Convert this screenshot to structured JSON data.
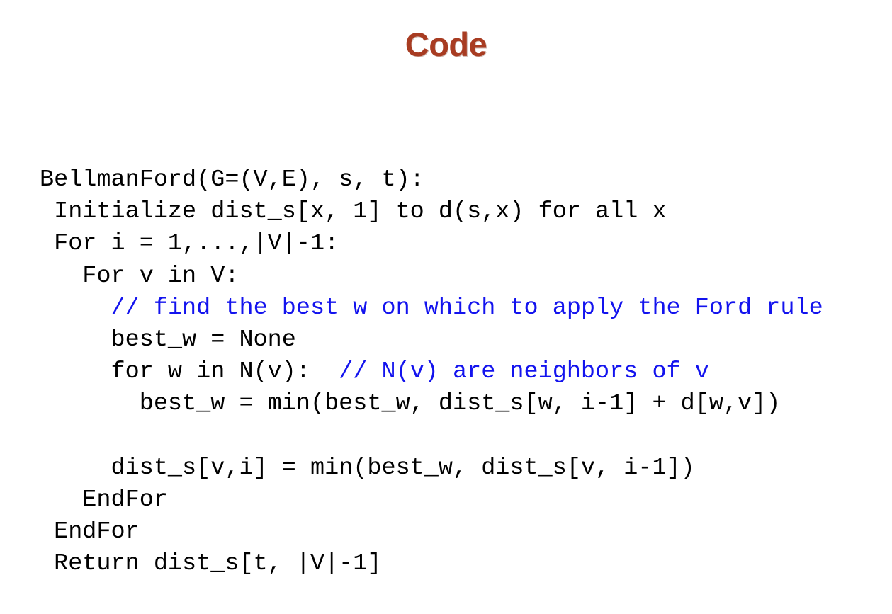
{
  "slide": {
    "title": "Code",
    "title_color": "#A83C22",
    "background_color": "#FFFFFF",
    "code_color": "#000000",
    "comment_color": "#1313EE"
  },
  "code": {
    "language": "pseudocode",
    "algorithm_name": "BellmanFord",
    "lines": [
      {
        "id": "line-1",
        "code": "BellmanFord(G=(V,E), s, t):",
        "comment": ""
      },
      {
        "id": "line-2",
        "code": " Initialize dist_s[x, 1] to d(s,x) for all x",
        "comment": ""
      },
      {
        "id": "line-3",
        "code": " For i = 1,...,|V|-1:",
        "comment": ""
      },
      {
        "id": "line-4",
        "code": "   For v in V:",
        "comment": ""
      },
      {
        "id": "line-5",
        "code": "     ",
        "comment": "// find the best w on which to apply the Ford rule"
      },
      {
        "id": "line-6",
        "code": "     best_w = None",
        "comment": ""
      },
      {
        "id": "line-7",
        "code": "     for w in N(v):  ",
        "comment": "// N(v) are neighbors of v"
      },
      {
        "id": "line-8",
        "code": "       best_w = min(best_w, dist_s[w, i-1] + d[w,v])",
        "comment": ""
      },
      {
        "id": "line-9",
        "code": "",
        "comment": ""
      },
      {
        "id": "line-10",
        "code": "     dist_s[v,i] = min(best_w, dist_s[v, i-1])",
        "comment": ""
      },
      {
        "id": "line-11",
        "code": "   EndFor",
        "comment": ""
      },
      {
        "id": "line-12",
        "code": " EndFor",
        "comment": ""
      },
      {
        "id": "line-13",
        "code": " Return dist_s[t, |V|-1]",
        "comment": ""
      }
    ]
  }
}
